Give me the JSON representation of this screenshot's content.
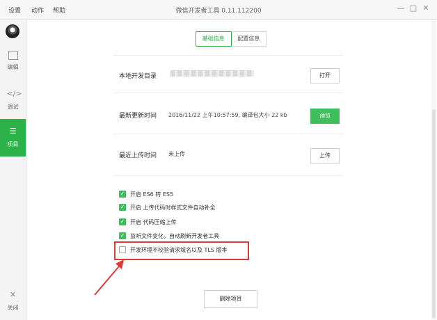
{
  "menu": {
    "settings": "设置",
    "action": "动作",
    "help": "帮助"
  },
  "window": {
    "title": "微信开发者工具 0.11.112200"
  },
  "sidebar": {
    "items": [
      {
        "label": "编辑",
        "icon": "edit-icon"
      },
      {
        "label": "调试",
        "icon": "code-icon"
      },
      {
        "label": "项目",
        "icon": "menu-icon",
        "active": true
      },
      {
        "label": "关闭",
        "icon": "close-icon"
      }
    ]
  },
  "tabs": [
    {
      "label": "基础信息",
      "active": true
    },
    {
      "label": "配置信息"
    }
  ],
  "project": {
    "dir_label": "本地开发目录",
    "dir_button": "打开",
    "update_label": "最新更新时间",
    "update_value": "2016/11/22 上午10:57:59, 编译包大小 22 kb",
    "preview_button": "预览",
    "upload_label": "最近上传时间",
    "upload_value": "未上传",
    "upload_button": "上传"
  },
  "options": [
    {
      "label": "开启 ES6 转 ES5",
      "checked": true
    },
    {
      "label": "开启 上传代码时样式文件自动补全",
      "checked": true
    },
    {
      "label": "开启 代码压缩上传",
      "checked": true
    },
    {
      "label": "监听文件变化，自动刷新开发者工具",
      "checked": true
    },
    {
      "label": "开发环境不校验请求域名以及 TLS 版本",
      "checked": false
    }
  ],
  "delete_button": "删除项目",
  "colors": {
    "accent": "#2bb34a",
    "highlight": "#e03a32"
  }
}
